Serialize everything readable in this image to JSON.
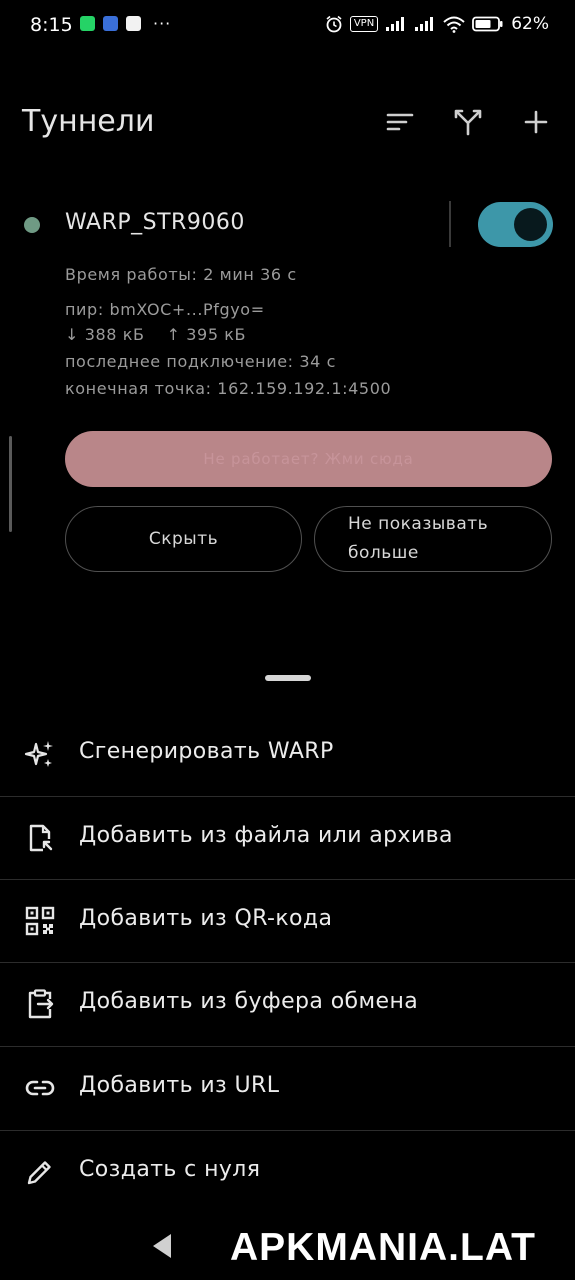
{
  "status_bar": {
    "time": "8:15",
    "overflow": "···",
    "vpn_badge": "VPN",
    "battery_percent": "62%",
    "app_icons": [
      "whatsapp-icon",
      "messenger-icon",
      "notes-icon"
    ],
    "right_icons": [
      "alarm-icon",
      "vpn-icon",
      "signal-icon",
      "signal-icon",
      "wifi-icon",
      "battery-icon"
    ]
  },
  "app_bar": {
    "title": "Туннели",
    "actions": [
      "sort-icon",
      "split-tunnel-icon",
      "add-icon"
    ]
  },
  "tunnel": {
    "name": "WARP_STR9060",
    "enabled": true,
    "status_color": "#6f9a84",
    "toggle_color": "#3d97a9",
    "uptime": "Время работы: 2 мин 36 с",
    "peer": "пир: bmXOC+...Pfgyo=",
    "rx": "↓ 388 кБ",
    "tx": "↑ 395 кБ",
    "last_handshake": "последнее подключение: 34 с",
    "endpoint": "конечная точка: 162.159.192.1:4500"
  },
  "actions": {
    "help_label": "Не работает? Жми сюда",
    "hide_label": "Скрыть",
    "dont_show_label": "Не показывать\nбольше"
  },
  "menu": {
    "items": [
      {
        "icon": "sparkle-icon",
        "label": "Сгенерировать WARP"
      },
      {
        "icon": "file-add-icon",
        "label": "Добавить из файла или архива"
      },
      {
        "icon": "qr-code-icon",
        "label": "Добавить из QR-кода"
      },
      {
        "icon": "clipboard-icon",
        "label": "Добавить из буфера обмена"
      },
      {
        "icon": "link-icon",
        "label": "Добавить из URL"
      },
      {
        "icon": "pencil-icon",
        "label": "Создать с нуля"
      }
    ]
  },
  "watermark": "APKMANIA.LAT",
  "colors": {
    "background": "#000000",
    "accent": "#3d97a9",
    "help_button": "#b98689"
  }
}
